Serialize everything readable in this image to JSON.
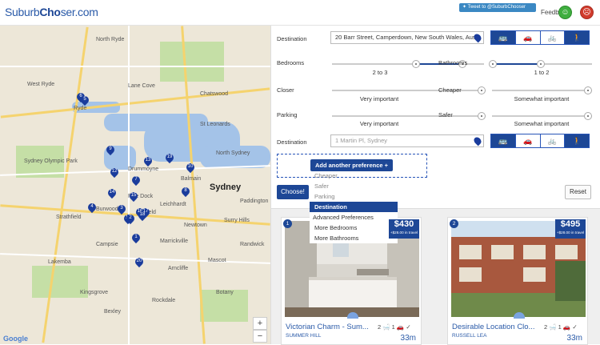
{
  "header": {
    "logo_part1": "Suburb",
    "logo_part2": "Cho",
    "logo_part3": "ser.com",
    "tweet_label": "Tweet to @SuburbChooser",
    "feedback_label": "Feedback:",
    "happy_glyph": "☺",
    "sad_glyph": "☹"
  },
  "map": {
    "labels": [
      "North Ryde",
      "West Ryde",
      "Ryde",
      "Lane Cove",
      "Sydney Olympic Park",
      "Chatswood",
      "St Leonards",
      "North Sydney",
      "Balmain",
      "Five Dock",
      "Drummoyne",
      "Strathfield",
      "Burwood",
      "Ashfield",
      "Leichhardt",
      "Surry Hills",
      "Marrickville",
      "Campsie",
      "Lakemba",
      "Kingsgrove",
      "Bexley",
      "Rockdale",
      "Arncliffe",
      "Mascot",
      "Botany",
      "Randwick",
      "Newtown",
      "Paddington"
    ],
    "city_label": "Sydney",
    "pins": [
      "6",
      "5",
      "9",
      "19",
      "13",
      "12",
      "7",
      "8",
      "10",
      "14",
      "15",
      "16",
      "17",
      "18",
      "11",
      "3",
      "4",
      "20",
      "1",
      "2"
    ],
    "zoom_in": "+",
    "zoom_out": "−",
    "attribution": "Google"
  },
  "prefs": {
    "dest1_label": "Destination",
    "dest1_value": "20 Barr Street, Camperdown, New South Wales, Aust",
    "bedrooms_label": "Bedrooms",
    "bedrooms_value": "2 to 3",
    "bedrooms_range": [
      0.55,
      0.85
    ],
    "bathrooms_label": "Bathrooms",
    "bathrooms_value": "1 to 2",
    "bathrooms_range": [
      0.0,
      0.5
    ],
    "closer_label": "Closer",
    "closer_value": "Very important",
    "cheaper_label": "Cheaper",
    "cheaper_value": "Somewhat important",
    "parking_label": "Parking",
    "parking_value": "Very important",
    "safer_label": "Safer",
    "safer_value": "Somewhat important",
    "dest2_label": "Destination",
    "dest2_placeholder": "1 Martin Pl, Sydney",
    "modes": [
      "✓",
      "🚌",
      "",
      "🚗",
      "",
      "🚲",
      "✓",
      "🚶"
    ],
    "add_button": "Add another preference +",
    "choose_button": "Choose!",
    "reset_button": "Reset"
  },
  "dropdown": {
    "items": [
      "Cheaper",
      "Safer",
      "Parking",
      "Destination"
    ],
    "selected": "Destination",
    "advanced_header": "Advanced Preferences",
    "advanced_items": [
      "More Bedrooms",
      "More Bathrooms"
    ]
  },
  "results": [
    {
      "rank": "1",
      "price": "$430",
      "travel": "+$28.00 in travel",
      "title": "Victorian Charm - Sum...",
      "suburb": "SUMMER HILL",
      "features": "2 🛁 1 🚗 ✓",
      "distance": "33m"
    },
    {
      "rank": "2",
      "price": "$495",
      "travel": "+$28.00 in travel",
      "title": "Desirable Location Clo...",
      "suburb": "RUSSELL LEA",
      "features": "2 🛁 1 🚗 ✓",
      "distance": "33m"
    }
  ]
}
